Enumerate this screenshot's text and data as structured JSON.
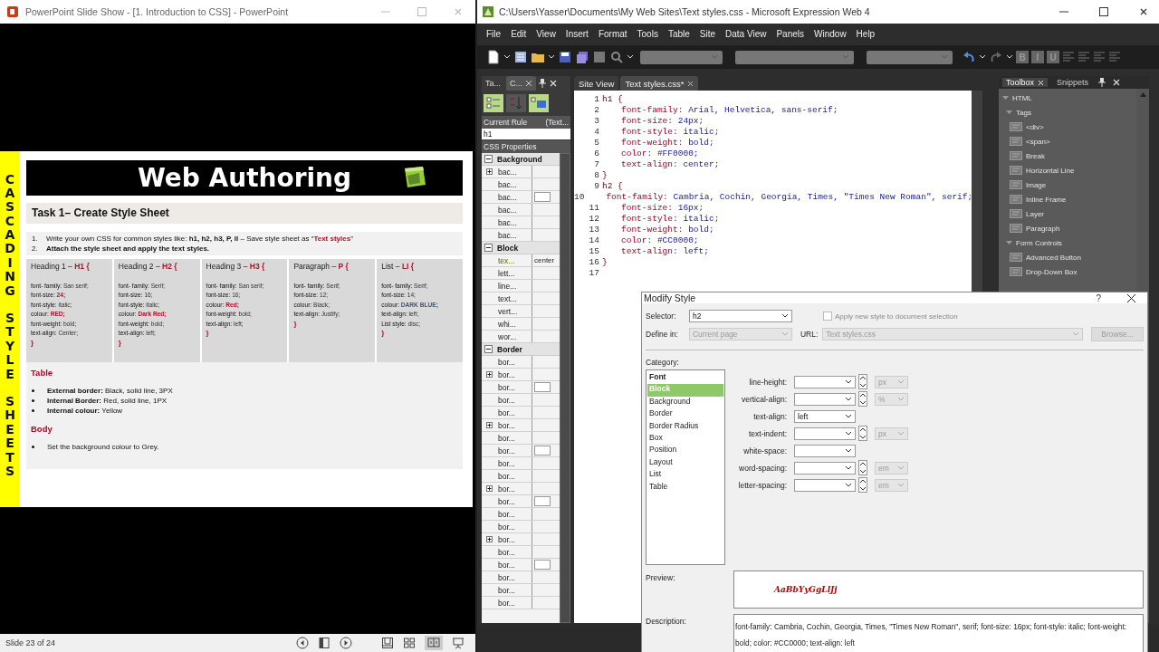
{
  "slideshow": {
    "title": "PowerPoint Slide Show - [1. Introduction to CSS] - PowerPoint",
    "slide": {
      "side_words": [
        "CASCADING",
        "STYLE",
        "SHEETS"
      ],
      "banner": "Web Authoring",
      "task": "Task 1– Create Style Sheet",
      "instructions": [
        {
          "number": "1.",
          "text": "Write your own CSS for common styles like:  **h1, h2, h3, P, ll** – Save style sheet as “**Text styles**”"
        },
        {
          "number": "2.",
          "text": "**Attach the style sheet and apply the text styles.**"
        }
      ],
      "cards": [
        {
          "label": "Heading 1 – ",
          "tag": "H1 {",
          "lines": [
            {
              "prop": "font- family:",
              "value": "San serif;",
              "kind": "plain"
            },
            {
              "prop": "font-size:",
              "value": "24;",
              "kind": "red"
            },
            {
              "prop": "font-style:",
              "value": "italic;",
              "kind": "plain"
            },
            {
              "prop": "colour:",
              "value": "RED;",
              "kind": "red"
            },
            {
              "prop": "font-weight:",
              "value": "bold;",
              "kind": "plain"
            },
            {
              "prop": "text-align:",
              "value": "Center;",
              "kind": "plain"
            }
          ],
          "close": "}"
        },
        {
          "label": "Heading 2 – ",
          "tag": "H2 {",
          "lines": [
            {
              "prop": "font- family:",
              "value": "Serif;",
              "kind": "plain"
            },
            {
              "prop": "font-size:",
              "value": "16;",
              "kind": "plain"
            },
            {
              "prop": "font-style:",
              "value": "italic;",
              "kind": "plain"
            },
            {
              "prop": "colour:",
              "value": "Dark Red;",
              "kind": "red"
            },
            {
              "prop": "font-weight:",
              "value": "bold;",
              "kind": "plain"
            },
            {
              "prop": "text-align:",
              "value": "left;",
              "kind": "plain"
            }
          ],
          "close": "}"
        },
        {
          "label": "Heading 3 – ",
          "tag": "H3 {",
          "lines": [
            {
              "prop": "font- family:",
              "value": "San serif;",
              "kind": "plain"
            },
            {
              "prop": "font-size:",
              "value": "16;",
              "kind": "plain"
            },
            {
              "prop": "colour:",
              "value": "Red;",
              "kind": "red"
            },
            {
              "prop": "font-weight:",
              "value": "bold;",
              "kind": "plain"
            },
            {
              "prop": "text-align:",
              "value": "left;",
              "kind": "plain"
            }
          ],
          "close": "}"
        },
        {
          "label": "Paragraph – ",
          "tag": "P {",
          "lines": [
            {
              "prop": "font- family:",
              "value": "Serif;",
              "kind": "plain"
            },
            {
              "prop": "font-size:",
              "value": "12;",
              "kind": "plain"
            },
            {
              "prop": "colour:",
              "value": "Black;",
              "kind": "plain"
            },
            {
              "prop": "text-align:",
              "value": "Justify;",
              "kind": "plain"
            }
          ],
          "close": "}"
        },
        {
          "label": "List – ",
          "tag": "LI {",
          "lines": [
            {
              "prop": "font- family:",
              "value": "Serif;",
              "kind": "plain"
            },
            {
              "prop": "font-size:",
              "value": "14;",
              "kind": "plain"
            },
            {
              "prop": "colour:",
              "value": "DARK BLUE;",
              "kind": "blue"
            },
            {
              "prop": "text-align:",
              "value": "left;",
              "kind": "plain"
            },
            {
              "prop": "List style:",
              "value": "disc;",
              "kind": "plain"
            }
          ],
          "close": "}"
        }
      ],
      "sections": [
        {
          "heading": "Table",
          "bullets": [
            "**External border:** Black, solid line, 3PX",
            "**Internal Border:** Red, solid line, 1PX",
            "**Internal colour:** Yellow"
          ]
        },
        {
          "heading": "Body",
          "bullets": [
            "Set the background colour to Grey."
          ]
        }
      ]
    },
    "status": "Slide 23 of 24"
  },
  "editor": {
    "title": "C:\\Users\\Yasser\\Documents\\My Web Sites\\Text styles.css - Microsoft Expression Web 4",
    "menu": [
      "File",
      "Edit",
      "View",
      "Insert",
      "Format",
      "Tools",
      "Table",
      "Site",
      "Data View",
      "Panels",
      "Window",
      "Help"
    ],
    "format_buttons": [
      "B",
      "I",
      "U"
    ],
    "panel": {
      "tabs": [
        {
          "label": "Ta...",
          "selected": false
        },
        {
          "label": "C...",
          "selected": true
        }
      ],
      "current_rule": "Current Rule",
      "rule_source": "(Text...",
      "rule_value": "h1",
      "properties_title": "CSS Properties",
      "groups": [
        {
          "label": "Background",
          "expanded": true,
          "rows": [
            {
              "name": "bac...",
              "expander": true,
              "swatch": false,
              "set": false
            },
            {
              "name": "bac...",
              "expander": false,
              "swatch": false,
              "set": false
            },
            {
              "name": "bac...",
              "expander": false,
              "swatch": true,
              "set": false
            },
            {
              "name": "bac...",
              "expander": false,
              "swatch": false,
              "set": false
            },
            {
              "name": "bac...",
              "expander": false,
              "swatch": false,
              "set": false
            },
            {
              "name": "bac...",
              "expander": false,
              "swatch": false,
              "set": false
            }
          ]
        },
        {
          "label": "Block",
          "expanded": true,
          "rows": [
            {
              "name": "tex...",
              "value": "center",
              "expander": false,
              "swatch": false,
              "set": true
            },
            {
              "name": "lett...",
              "expander": false,
              "swatch": false,
              "set": false
            },
            {
              "name": "line...",
              "expander": false,
              "swatch": false,
              "set": false
            },
            {
              "name": "text...",
              "expander": false,
              "swatch": false,
              "set": false
            },
            {
              "name": "vert...",
              "expander": false,
              "swatch": false,
              "set": false
            },
            {
              "name": "whi...",
              "expander": false,
              "swatch": false,
              "set": false
            },
            {
              "name": "wor...",
              "expander": false,
              "swatch": false,
              "set": false
            }
          ]
        },
        {
          "label": "Border",
          "expanded": true,
          "rows": [
            {
              "name": "bor...",
              "expander": false,
              "swatch": false,
              "set": false
            },
            {
              "name": "bor...",
              "expander": true,
              "swatch": false,
              "set": false
            },
            {
              "name": "bor...",
              "expander": false,
              "swatch": true,
              "set": false
            },
            {
              "name": "bor...",
              "expander": false,
              "swatch": false,
              "set": false
            },
            {
              "name": "bor...",
              "expander": false,
              "swatch": false,
              "set": false
            },
            {
              "name": "bor...",
              "expander": true,
              "swatch": false,
              "set": false
            },
            {
              "name": "bor...",
              "expander": false,
              "swatch": false,
              "set": false
            },
            {
              "name": "bor...",
              "expander": false,
              "swatch": true,
              "set": false
            },
            {
              "name": "bor...",
              "expander": false,
              "swatch": false,
              "set": false
            },
            {
              "name": "bor...",
              "expander": false,
              "swatch": false,
              "set": false
            },
            {
              "name": "bor...",
              "expander": true,
              "swatch": false,
              "set": false
            },
            {
              "name": "bor...",
              "expander": false,
              "swatch": true,
              "set": false
            },
            {
              "name": "bor...",
              "expander": false,
              "swatch": false,
              "set": false
            },
            {
              "name": "bor...",
              "expander": false,
              "swatch": false,
              "set": false
            },
            {
              "name": "bor...",
              "expander": true,
              "swatch": false,
              "set": false
            },
            {
              "name": "bor...",
              "expander": false,
              "swatch": false,
              "set": false
            },
            {
              "name": "bor...",
              "expander": false,
              "swatch": true,
              "set": false
            },
            {
              "name": "bor...",
              "expander": false,
              "swatch": false,
              "set": false
            },
            {
              "name": "bor...",
              "expander": false,
              "swatch": false,
              "set": false
            },
            {
              "name": "bor...",
              "expander": false,
              "swatch": false,
              "set": false
            }
          ]
        }
      ]
    },
    "doc_tabs": [
      {
        "label": "Site View",
        "selected": false,
        "closable": false
      },
      {
        "label": "Text styles.css*",
        "selected": true,
        "closable": true
      }
    ],
    "code": [
      {
        "n": "1",
        "kind": "open",
        "text": "h1 {"
      },
      {
        "n": "2",
        "kind": "decl",
        "prop": "font-family:",
        "value": "Arial, Helvetica, sans-serif;"
      },
      {
        "n": "3",
        "kind": "decl",
        "prop": "font-size:",
        "value": "24px;"
      },
      {
        "n": "4",
        "kind": "decl",
        "prop": "font-style:",
        "value": "italic;"
      },
      {
        "n": "5",
        "kind": "decl",
        "prop": "font-weight:",
        "value": "bold;"
      },
      {
        "n": "6",
        "kind": "decl",
        "prop": "color:",
        "value": "#FF0000;"
      },
      {
        "n": "7",
        "kind": "decl",
        "prop": "text-align:",
        "value": "center;"
      },
      {
        "n": "8",
        "kind": "close",
        "text": "}"
      },
      {
        "n": "9",
        "kind": "open",
        "text": "h2 {"
      },
      {
        "n": "10",
        "kind": "decl",
        "prop": "font-family:",
        "value": "Cambria, Cochin, Georgia, Times, \"Times New Roman\", serif;"
      },
      {
        "n": "11",
        "kind": "decl",
        "prop": "font-size:",
        "value": "16px;"
      },
      {
        "n": "12",
        "kind": "decl",
        "prop": "font-style:",
        "value": "italic;"
      },
      {
        "n": "13",
        "kind": "decl",
        "prop": "font-weight:",
        "value": "bold;"
      },
      {
        "n": "14",
        "kind": "decl",
        "prop": "color:",
        "value": "#CC0000;"
      },
      {
        "n": "15",
        "kind": "decl",
        "prop": "text-align:",
        "value": "left;"
      },
      {
        "n": "16",
        "kind": "close",
        "text": "}"
      },
      {
        "n": "17",
        "kind": "blank"
      }
    ],
    "toolbox": {
      "tabs": [
        {
          "label": "Toolbox",
          "selected": true,
          "closable": true
        },
        {
          "label": "Snippets",
          "selected": false,
          "closable": false
        }
      ],
      "tree": [
        {
          "label": "HTML",
          "expanded": true,
          "children": [
            {
              "label": "Tags",
              "expanded": true,
              "children": [
                {
                  "label": "<div>"
                },
                {
                  "label": "<span>"
                },
                {
                  "label": "Break"
                },
                {
                  "label": "Horizontal Line"
                },
                {
                  "label": "Image"
                },
                {
                  "label": "Inline Frame"
                },
                {
                  "label": "Layer"
                },
                {
                  "label": "Paragraph"
                }
              ]
            },
            {
              "label": "Form Controls",
              "expanded": true,
              "children": [
                {
                  "label": "Advanced Button"
                },
                {
                  "label": "Drop-Down Box"
                }
              ]
            }
          ]
        }
      ]
    }
  },
  "dialog": {
    "title": "Modify Style",
    "help": "?",
    "selector": {
      "label": "Selector:",
      "value": "h2"
    },
    "apply": {
      "label": "Apply new style to document selection",
      "checked": false
    },
    "define_in": {
      "label": "Define in:",
      "value": "Current page",
      "disabled": true
    },
    "url": {
      "label": "URL:",
      "value": "Text styles.css",
      "disabled": true
    },
    "browse": {
      "label": "Browse...",
      "disabled": true
    },
    "category_label": "Category:",
    "categories": [
      {
        "label": "Font",
        "selected": false,
        "modified": true
      },
      {
        "label": "Block",
        "selected": true,
        "modified": true
      },
      {
        "label": "Background",
        "selected": false,
        "modified": false
      },
      {
        "label": "Border",
        "selected": false,
        "modified": false
      },
      {
        "label": "Border Radius",
        "selected": false,
        "modified": false
      },
      {
        "label": "Box",
        "selected": false,
        "modified": false
      },
      {
        "label": "Position",
        "selected": false,
        "modified": false
      },
      {
        "label": "Layout",
        "selected": false,
        "modified": false
      },
      {
        "label": "List",
        "selected": false,
        "modified": false
      },
      {
        "label": "Table",
        "selected": false,
        "modified": false
      }
    ],
    "fields": [
      {
        "label": "line-height:",
        "kind": "spin",
        "unit": "px"
      },
      {
        "label": "vertical-align:",
        "kind": "spin",
        "unit": "%"
      },
      {
        "label": "text-align:",
        "kind": "plain",
        "value": "left"
      },
      {
        "label": "text-indent:",
        "kind": "spin",
        "unit": "px"
      },
      {
        "label": "white-space:",
        "kind": "plain"
      },
      {
        "label": "word-spacing:",
        "kind": "spin",
        "unit": "em"
      },
      {
        "label": "letter-spacing:",
        "kind": "spin",
        "unit": "em"
      }
    ],
    "preview_label": "Preview:",
    "preview": "AaBbYyGgLlJj",
    "description_label": "Description:",
    "description": "font-family: Cambria, Cochin, Georgia, Times, \"Times New Roman\", serif; font-size: 16px; font-style: italic; font-weight: bold; color: #CC0000; text-align: left"
  }
}
